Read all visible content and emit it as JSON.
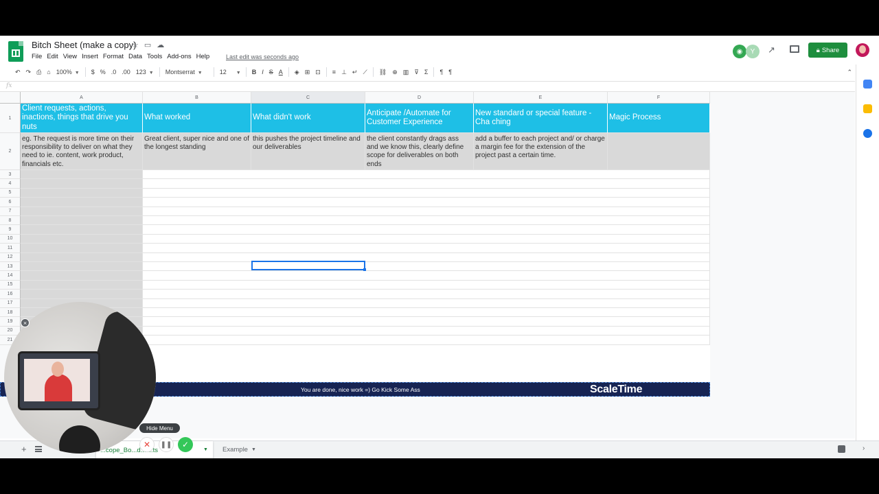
{
  "document": {
    "title": "Bitch Sheet (make a copy)",
    "menu": [
      "File",
      "Edit",
      "View",
      "Insert",
      "Format",
      "Data",
      "Tools",
      "Add-ons",
      "Help"
    ],
    "last_edit": "Last edit was seconds ago",
    "share_label": "Share"
  },
  "toolbar": {
    "zoom": "100%",
    "currency": "$",
    "percent": "%",
    "decimal_decrease": ".0",
    "decimal_increase": ".00",
    "number_format": "123",
    "font": "Montserrat",
    "font_size": "12",
    "bold": "B",
    "italic": "I",
    "strike": "S",
    "text_color": "A",
    "sigma": "Σ"
  },
  "formula_bar": {
    "fx": "fx"
  },
  "columns": [
    "A",
    "B",
    "C",
    "D",
    "E",
    "F"
  ],
  "rows": [
    "1",
    "2",
    "3",
    "4",
    "5",
    "6",
    "7",
    "8",
    "9",
    "10",
    "11",
    "12",
    "13",
    "14",
    "15",
    "16",
    "17",
    "18",
    "19",
    "20",
    "21"
  ],
  "header_row": {
    "a": "Client requests, actions, inactions, things that drive you nuts",
    "b": "What worked",
    "c": "What didn't work",
    "d": "Anticipate /Automate for Customer Experience",
    "e": "New standard or special feature - Cha ching",
    "f": "Magic Process"
  },
  "example_row": {
    "a": "eg. The request is more time on their responsibility to deliver on what they need to ie. content, work product, financials etc.",
    "b": "Great client, super nice and one of the longest standing",
    "c": "this pushes the project timeline and our deliverables",
    "d": "the client constantly drags ass and we know this, clearly define scope for deliverables on both ends",
    "e": "add a buffer to each project and/ or charge a margin fee for the extension of the project past a certain time.",
    "f": ""
  },
  "banner": {
    "text": "You are done, nice work =) Go Kick Some Ass",
    "brand": "ScaleTime"
  },
  "tabs": {
    "active": "...cope_Bo...d...l...ts",
    "other": "Example"
  },
  "recorder": {
    "hide_menu": "Hide Menu"
  },
  "colors": {
    "header_fill": "#1ebfe6",
    "banner_fill": "#172453",
    "share_green": "#1e8e3e"
  }
}
